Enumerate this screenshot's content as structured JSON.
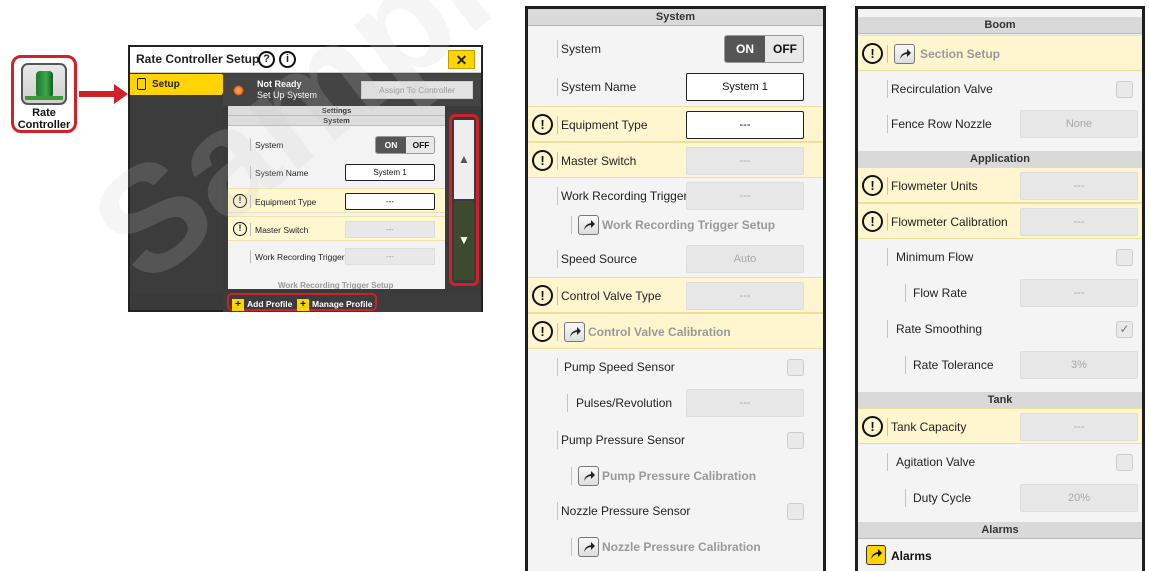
{
  "app_icon": {
    "label_line1": "Rate",
    "label_line2": "Controller"
  },
  "screen": {
    "title": "Rate Controller Setup",
    "help_icon": "?",
    "info_icon": "i",
    "close_label": "✕",
    "side_tab": "Setup",
    "status_title": "Not Ready",
    "status_sub": "Set Up System",
    "assign_button": "Assign To Controller",
    "settings_header": "Settings",
    "system_header": "System",
    "rows": {
      "system": "System",
      "system_name": "System Name",
      "system_name_value": "System 1",
      "equipment_type": "Equipment Type",
      "equipment_value": "---",
      "master_switch": "Master Switch",
      "master_value": "---",
      "work_trigger": "Work Recording Trigger",
      "work_value": "---",
      "work_setup": "Work Recording Trigger Setup"
    },
    "toggle_on": "ON",
    "toggle_off": "OFF",
    "scroll_up": "▲",
    "scroll_down": "▼",
    "add_profile": "Add Profile",
    "manage_profile": "Manage Profile",
    "plus": "+"
  },
  "panel1": {
    "header": "System",
    "warn_icon": "!",
    "system": "System",
    "toggle_on": "ON",
    "toggle_off": "OFF",
    "system_name": "System Name",
    "system_name_value": "System 1",
    "equipment_type": "Equipment Type",
    "equipment_value": "---",
    "master_switch": "Master Switch",
    "master_value": "---",
    "work_trigger": "Work Recording Trigger",
    "work_value": "---",
    "work_setup": "Work Recording Trigger Setup",
    "speed_source": "Speed Source",
    "speed_value": "Auto",
    "control_valve_type": "Control Valve Type",
    "control_valve_value": "---",
    "control_valve_calibration": "Control Valve Calibration",
    "pump_speed_sensor": "Pump Speed Sensor",
    "pulses": "Pulses/Revolution",
    "pulses_value": "---",
    "pump_pressure_sensor": "Pump Pressure Sensor",
    "pump_pressure_calibration": "Pump Pressure Calibration",
    "nozzle_pressure_sensor": "Nozzle Pressure Sensor",
    "nozzle_pressure_calibration": "Nozzle Pressure Calibration"
  },
  "panel2": {
    "boom_header": "Boom",
    "warn_icon": "!",
    "section_setup": "Section Setup",
    "recirculation_valve": "Recirculation Valve",
    "fence_row_nozzle": "Fence Row Nozzle",
    "fence_value": "None",
    "application_header": "Application",
    "flowmeter_units": "Flowmeter Units",
    "flowmeter_units_value": "---",
    "flowmeter_calibration": "Flowmeter Calibration",
    "flowmeter_calibration_value": "---",
    "minimum_flow": "Minimum Flow",
    "flow_rate": "Flow Rate",
    "flow_rate_value": "---",
    "rate_smoothing": "Rate Smoothing",
    "checkmark": "✓",
    "rate_tolerance": "Rate Tolerance",
    "rate_tolerance_value": "3%",
    "tank_header": "Tank",
    "tank_capacity": "Tank Capacity",
    "tank_capacity_value": "---",
    "agitation_valve": "Agitation Valve",
    "duty_cycle": "Duty Cycle",
    "duty_cycle_value": "20%",
    "alarms_header": "Alarms",
    "alarms": "Alarms"
  },
  "watermark": "SamplePoint A",
  "colors": {
    "accent": "#ffd400",
    "highlight": "#d0202a",
    "warning_row": "#fff6cf"
  }
}
